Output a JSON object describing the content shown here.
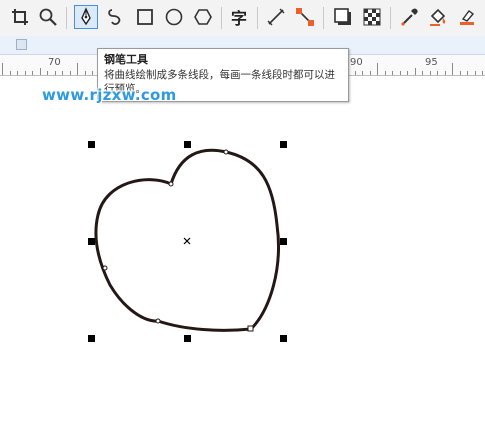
{
  "toolbar": {
    "tools": [
      {
        "name": "crop-tool-icon"
      },
      {
        "name": "zoom-tool-icon"
      },
      {
        "name": "pen-tool-icon",
        "active": true
      },
      {
        "name": "freehand-tool-icon"
      },
      {
        "name": "rectangle-tool-icon"
      },
      {
        "name": "ellipse-tool-icon"
      },
      {
        "name": "polygon-tool-icon"
      },
      {
        "name": "text-tool-icon",
        "glyph": "字"
      },
      {
        "name": "dimension-line-tool-icon"
      },
      {
        "name": "connector-tool-icon"
      },
      {
        "name": "drop-shadow-tool-icon"
      },
      {
        "name": "transparency-tool-icon"
      },
      {
        "name": "eyedropper-tool-icon"
      },
      {
        "name": "fill-tool-icon"
      },
      {
        "name": "smart-fill-tool-icon"
      }
    ]
  },
  "ruler": {
    "labels": [
      "70",
      "90",
      "95"
    ]
  },
  "tooltip": {
    "title": "钢笔工具",
    "body": "将曲线绘制成多条线段，每画一条线段时都可以进行预览。"
  },
  "watermark": {
    "text": "www.rjzxw.com"
  },
  "colors": {
    "accent": "#4a90d9",
    "watermark": "#2e9be0",
    "curve": "#231815",
    "handle": "#000000"
  }
}
